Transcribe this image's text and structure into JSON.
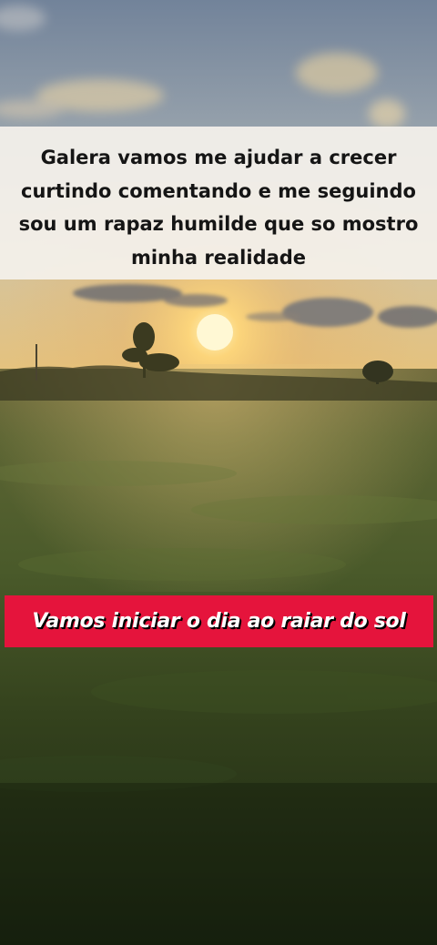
{
  "top_caption": {
    "lines": [
      "Galera vamos me ajudar a crecer",
      "curtindo comentando e me seguindo",
      "sou um rapaz humilde que so mostro",
      "minha realidade"
    ]
  },
  "banner": {
    "text": "Vamos iniciar o dia ao raiar do sol",
    "color": "#e5143c"
  },
  "colors": {
    "sky_top": "#7d8ea3",
    "sun": "#fff7c9",
    "field": "#3c4d22"
  }
}
